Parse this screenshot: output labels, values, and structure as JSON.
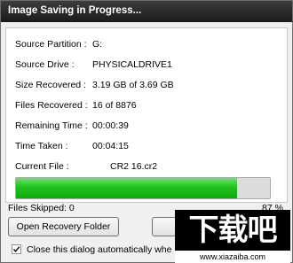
{
  "dialog": {
    "title": "Image Saving in Progress..."
  },
  "details": {
    "source_partition": {
      "label": "Source Partition :",
      "value": "G:"
    },
    "source_drive": {
      "label": "Source Drive :",
      "value": "PHYSICALDRIVE1"
    },
    "size_recovered": {
      "label": "Size Recovered :",
      "value": "3.19 GB of 3.69 GB"
    },
    "files_recovered": {
      "label": "Files Recovered :",
      "value": "16 of 8876"
    },
    "remaining_time": {
      "label": "Remaining Time :",
      "value": "00:00:39"
    },
    "time_taken": {
      "label": "Time Taken :",
      "value": "00:04:15"
    },
    "current_file": {
      "label": "Current File :",
      "value": "CR2 16.cr2"
    }
  },
  "progress": {
    "percent_value": 0.87,
    "percent_text": "87 %"
  },
  "footer": {
    "files_skipped": "Files Skipped: 0",
    "open_folder_button": "Open Recovery Folder",
    "second_button": "Pa",
    "close_checkbox_label": "Close this dialog automatically whe",
    "close_checkbox_checked": true
  },
  "watermark": {
    "logo_text": "下载吧",
    "url": "www.xiazaiba.com"
  },
  "colors": {
    "title_bar": "#1a1a1a",
    "progress_fill": "#1fc21f"
  }
}
